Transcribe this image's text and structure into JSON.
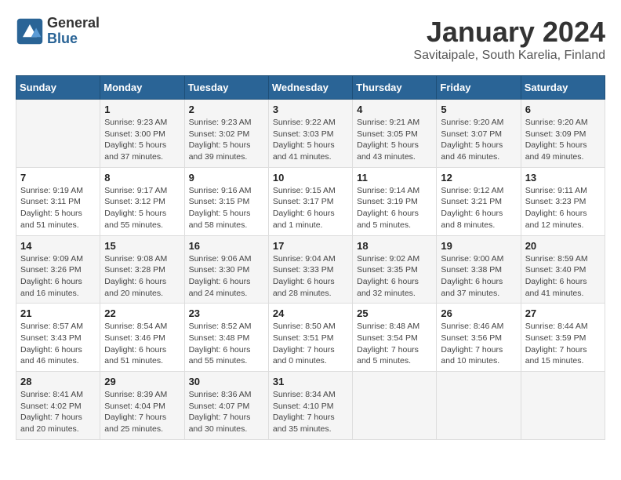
{
  "header": {
    "logo_general": "General",
    "logo_blue": "Blue",
    "title": "January 2024",
    "subtitle": "Savitaipale, South Karelia, Finland"
  },
  "days_of_week": [
    "Sunday",
    "Monday",
    "Tuesday",
    "Wednesday",
    "Thursday",
    "Friday",
    "Saturday"
  ],
  "weeks": [
    [
      {
        "day": "",
        "info": ""
      },
      {
        "day": "1",
        "info": "Sunrise: 9:23 AM\nSunset: 3:00 PM\nDaylight: 5 hours\nand 37 minutes."
      },
      {
        "day": "2",
        "info": "Sunrise: 9:23 AM\nSunset: 3:02 PM\nDaylight: 5 hours\nand 39 minutes."
      },
      {
        "day": "3",
        "info": "Sunrise: 9:22 AM\nSunset: 3:03 PM\nDaylight: 5 hours\nand 41 minutes."
      },
      {
        "day": "4",
        "info": "Sunrise: 9:21 AM\nSunset: 3:05 PM\nDaylight: 5 hours\nand 43 minutes."
      },
      {
        "day": "5",
        "info": "Sunrise: 9:20 AM\nSunset: 3:07 PM\nDaylight: 5 hours\nand 46 minutes."
      },
      {
        "day": "6",
        "info": "Sunrise: 9:20 AM\nSunset: 3:09 PM\nDaylight: 5 hours\nand 49 minutes."
      }
    ],
    [
      {
        "day": "7",
        "info": "Sunrise: 9:19 AM\nSunset: 3:11 PM\nDaylight: 5 hours\nand 51 minutes."
      },
      {
        "day": "8",
        "info": "Sunrise: 9:17 AM\nSunset: 3:12 PM\nDaylight: 5 hours\nand 55 minutes."
      },
      {
        "day": "9",
        "info": "Sunrise: 9:16 AM\nSunset: 3:15 PM\nDaylight: 5 hours\nand 58 minutes."
      },
      {
        "day": "10",
        "info": "Sunrise: 9:15 AM\nSunset: 3:17 PM\nDaylight: 6 hours\nand 1 minute."
      },
      {
        "day": "11",
        "info": "Sunrise: 9:14 AM\nSunset: 3:19 PM\nDaylight: 6 hours\nand 5 minutes."
      },
      {
        "day": "12",
        "info": "Sunrise: 9:12 AM\nSunset: 3:21 PM\nDaylight: 6 hours\nand 8 minutes."
      },
      {
        "day": "13",
        "info": "Sunrise: 9:11 AM\nSunset: 3:23 PM\nDaylight: 6 hours\nand 12 minutes."
      }
    ],
    [
      {
        "day": "14",
        "info": "Sunrise: 9:09 AM\nSunset: 3:26 PM\nDaylight: 6 hours\nand 16 minutes."
      },
      {
        "day": "15",
        "info": "Sunrise: 9:08 AM\nSunset: 3:28 PM\nDaylight: 6 hours\nand 20 minutes."
      },
      {
        "day": "16",
        "info": "Sunrise: 9:06 AM\nSunset: 3:30 PM\nDaylight: 6 hours\nand 24 minutes."
      },
      {
        "day": "17",
        "info": "Sunrise: 9:04 AM\nSunset: 3:33 PM\nDaylight: 6 hours\nand 28 minutes."
      },
      {
        "day": "18",
        "info": "Sunrise: 9:02 AM\nSunset: 3:35 PM\nDaylight: 6 hours\nand 32 minutes."
      },
      {
        "day": "19",
        "info": "Sunrise: 9:00 AM\nSunset: 3:38 PM\nDaylight: 6 hours\nand 37 minutes."
      },
      {
        "day": "20",
        "info": "Sunrise: 8:59 AM\nSunset: 3:40 PM\nDaylight: 6 hours\nand 41 minutes."
      }
    ],
    [
      {
        "day": "21",
        "info": "Sunrise: 8:57 AM\nSunset: 3:43 PM\nDaylight: 6 hours\nand 46 minutes."
      },
      {
        "day": "22",
        "info": "Sunrise: 8:54 AM\nSunset: 3:46 PM\nDaylight: 6 hours\nand 51 minutes."
      },
      {
        "day": "23",
        "info": "Sunrise: 8:52 AM\nSunset: 3:48 PM\nDaylight: 6 hours\nand 55 minutes."
      },
      {
        "day": "24",
        "info": "Sunrise: 8:50 AM\nSunset: 3:51 PM\nDaylight: 7 hours\nand 0 minutes."
      },
      {
        "day": "25",
        "info": "Sunrise: 8:48 AM\nSunset: 3:54 PM\nDaylight: 7 hours\nand 5 minutes."
      },
      {
        "day": "26",
        "info": "Sunrise: 8:46 AM\nSunset: 3:56 PM\nDaylight: 7 hours\nand 10 minutes."
      },
      {
        "day": "27",
        "info": "Sunrise: 8:44 AM\nSunset: 3:59 PM\nDaylight: 7 hours\nand 15 minutes."
      }
    ],
    [
      {
        "day": "28",
        "info": "Sunrise: 8:41 AM\nSunset: 4:02 PM\nDaylight: 7 hours\nand 20 minutes."
      },
      {
        "day": "29",
        "info": "Sunrise: 8:39 AM\nSunset: 4:04 PM\nDaylight: 7 hours\nand 25 minutes."
      },
      {
        "day": "30",
        "info": "Sunrise: 8:36 AM\nSunset: 4:07 PM\nDaylight: 7 hours\nand 30 minutes."
      },
      {
        "day": "31",
        "info": "Sunrise: 8:34 AM\nSunset: 4:10 PM\nDaylight: 7 hours\nand 35 minutes."
      },
      {
        "day": "",
        "info": ""
      },
      {
        "day": "",
        "info": ""
      },
      {
        "day": "",
        "info": ""
      }
    ]
  ]
}
